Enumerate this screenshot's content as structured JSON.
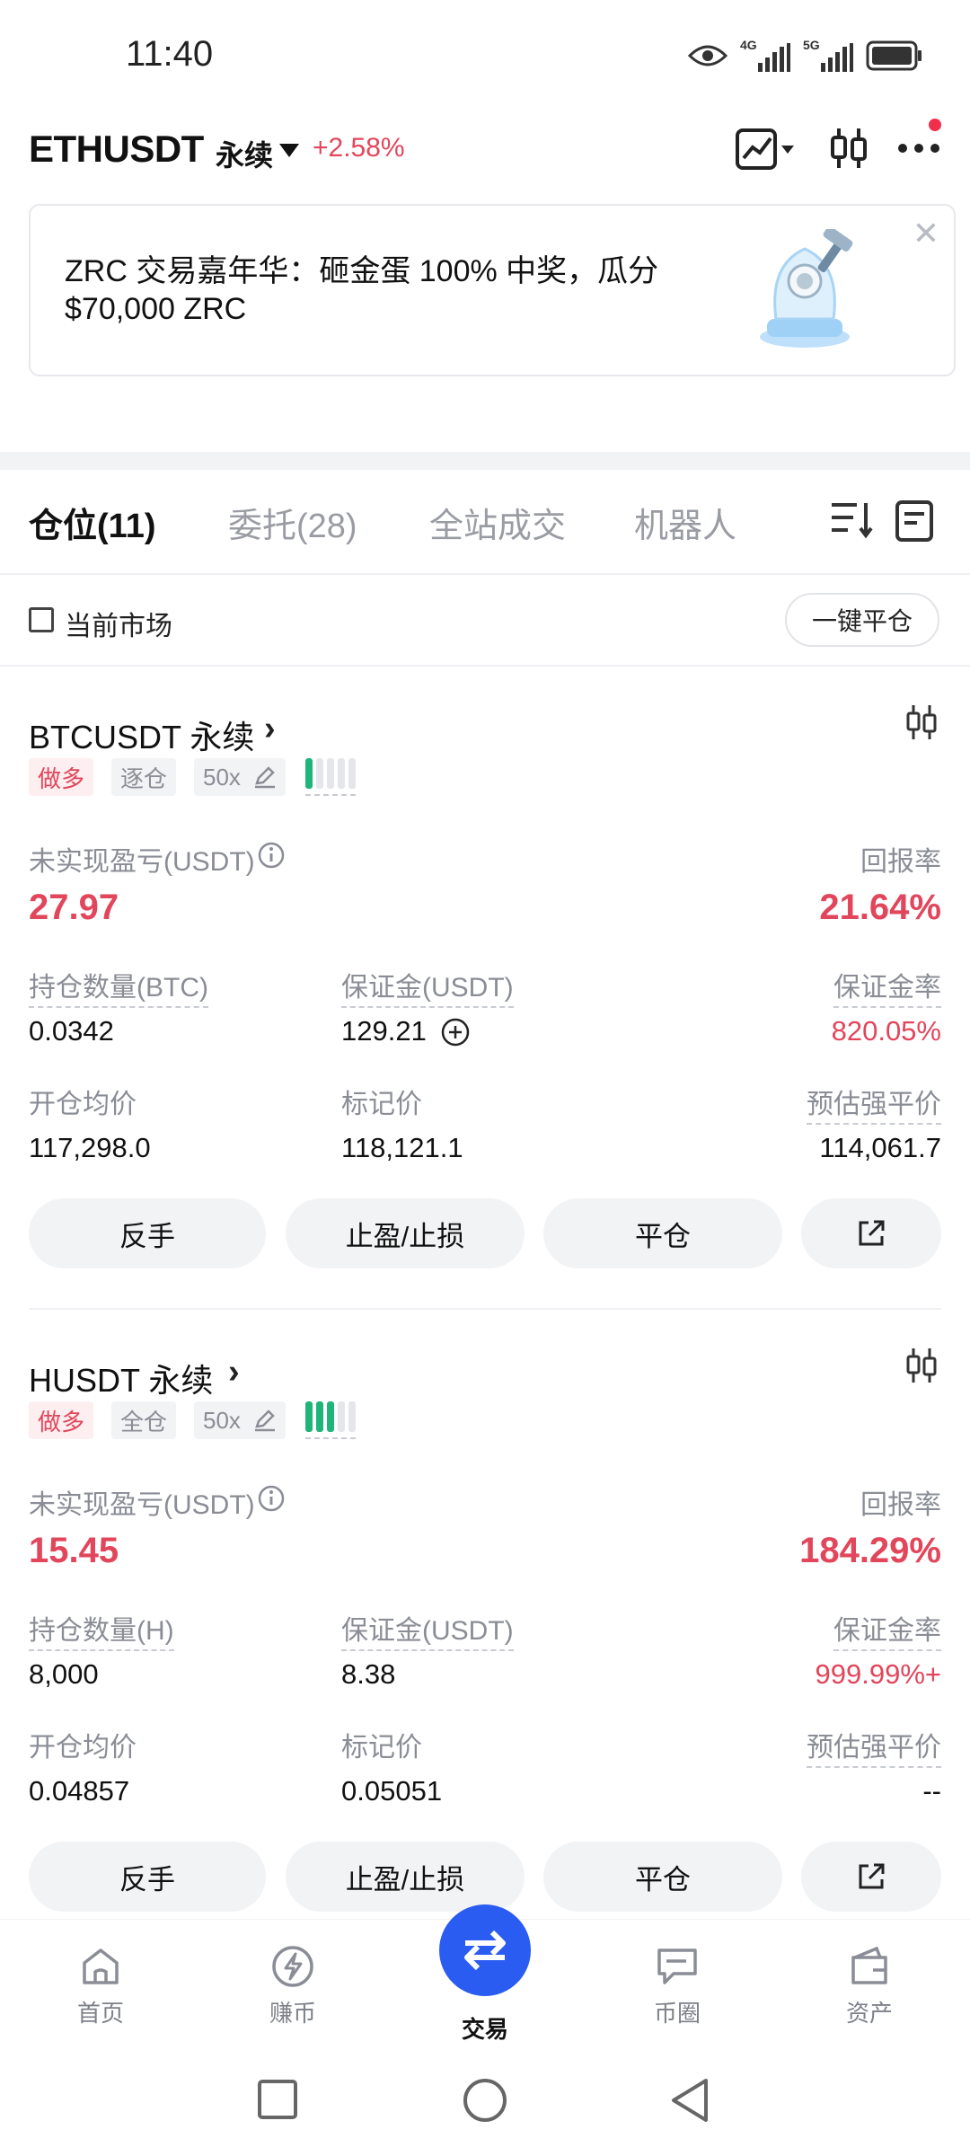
{
  "status": {
    "time": "11:40",
    "net1": "4G",
    "net2": "5G"
  },
  "header": {
    "pair": "ETHUSDT",
    "type": "永续",
    "change": "+2.58%"
  },
  "banner": {
    "text": "ZRC 交易嘉年华：砸金蛋 100% 中奖，瓜分 $70,000 ZRC",
    "close_label": "✕"
  },
  "tabs": [
    {
      "label": "仓位(11)",
      "active": true
    },
    {
      "label": "委托(28)",
      "active": false
    },
    {
      "label": "全站成交",
      "active": false
    },
    {
      "label": "机器人",
      "active": false
    }
  ],
  "filter": {
    "current_market_label": "当前市场",
    "close_all_label": "一键平仓"
  },
  "positions": [
    {
      "symbol": "BTCUSDT 永续",
      "side": "做多",
      "margin_mode": "逐仓",
      "leverage": "50x",
      "risk_level": 1,
      "unrealized_pnl_label": "未实现盈亏(USDT)",
      "unrealized_pnl": "27.97",
      "roe_label": "回报率",
      "roe": "21.64%",
      "size_label": "持仓数量(BTC)",
      "size": "0.0342",
      "margin_label": "保证金(USDT)",
      "margin": "129.21",
      "margin_ratio_label": "保证金率",
      "margin_ratio": "820.05%",
      "entry_label": "开仓均价",
      "entry": "117,298.0",
      "mark_label": "标记价",
      "mark": "118,121.1",
      "liq_label": "预估强平价",
      "liq": "114,061.7",
      "btn_reverse": "反手",
      "btn_tpsl": "止盈/止损",
      "btn_close": "平仓"
    },
    {
      "symbol": "HUSDT 永续",
      "side": "做多",
      "margin_mode": "全仓",
      "leverage": "50x",
      "risk_level": 3,
      "unrealized_pnl_label": "未实现盈亏(USDT)",
      "unrealized_pnl": "15.45",
      "roe_label": "回报率",
      "roe": "184.29%",
      "size_label": "持仓数量(H)",
      "size": "8,000",
      "margin_label": "保证金(USDT)",
      "margin": "8.38",
      "margin_ratio_label": "保证金率",
      "margin_ratio": "999.99%+",
      "entry_label": "开仓均价",
      "entry": "0.04857",
      "mark_label": "标记价",
      "mark": "0.05051",
      "liq_label": "预估强平价",
      "liq": "--",
      "btn_reverse": "反手",
      "btn_tpsl": "止盈/止损",
      "btn_close": "平仓"
    }
  ],
  "bottom_nav": [
    {
      "label": "首页",
      "icon": "home-icon"
    },
    {
      "label": "赚币",
      "icon": "earn-icon"
    },
    {
      "label": "交易",
      "icon": "trade-icon",
      "active": true
    },
    {
      "label": "币圈",
      "icon": "community-icon"
    },
    {
      "label": "资产",
      "icon": "wallet-icon"
    }
  ],
  "colors": {
    "accent": "#2b5cf1",
    "red": "#e2465b",
    "green": "#1fb57a"
  }
}
